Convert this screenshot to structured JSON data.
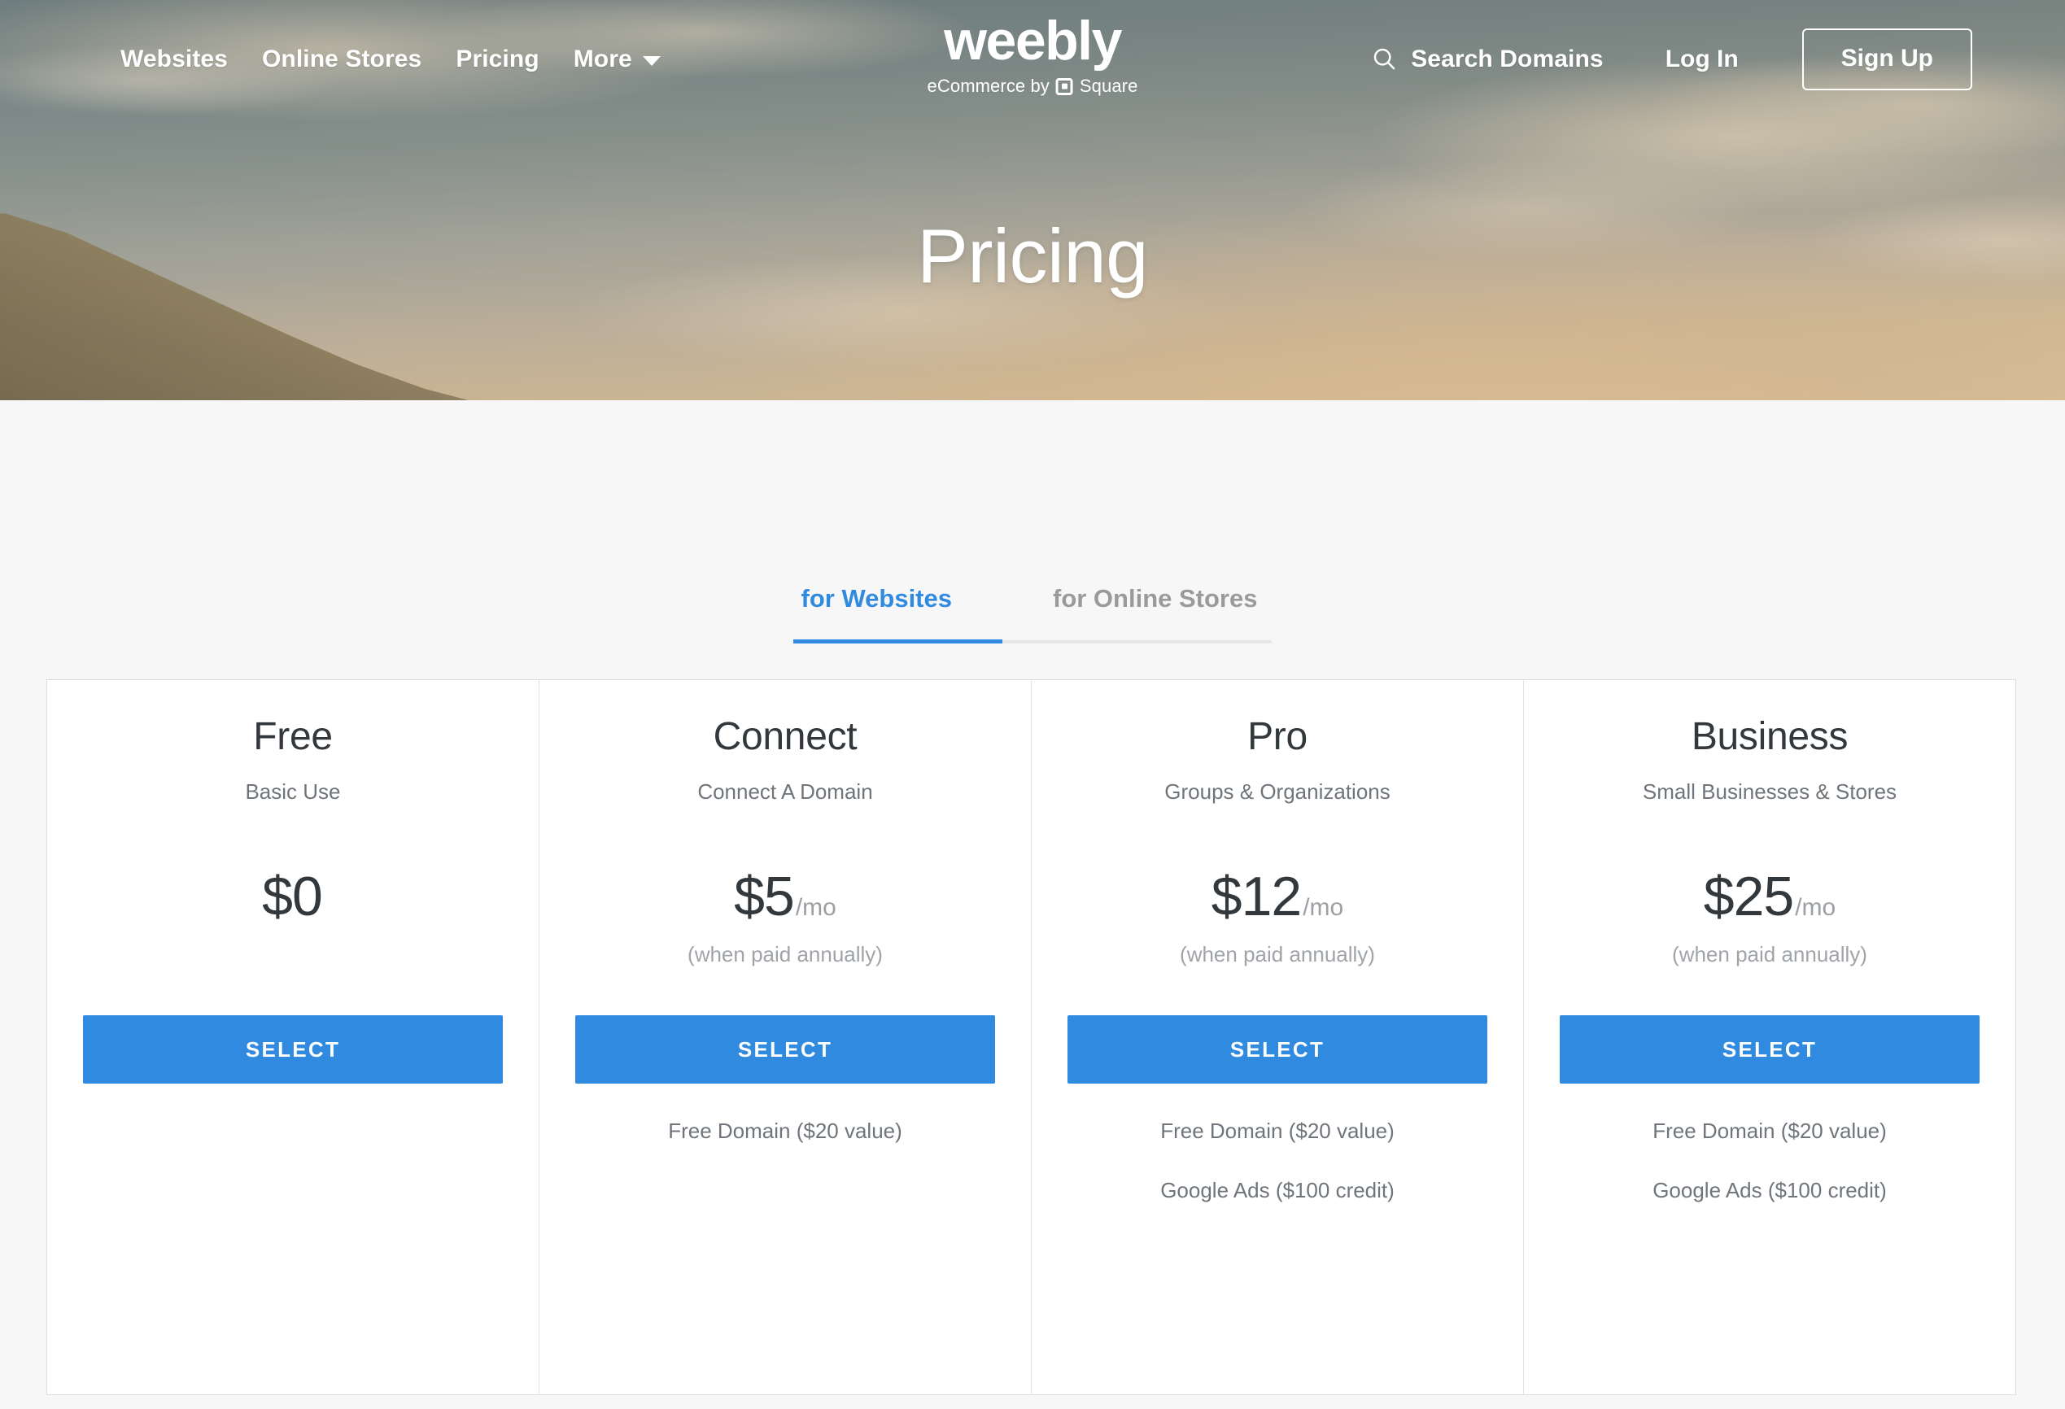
{
  "nav": {
    "links": [
      {
        "label": "Websites"
      },
      {
        "label": "Online Stores"
      },
      {
        "label": "Pricing"
      },
      {
        "label": "More"
      }
    ],
    "logo": {
      "wordmark": "weebly",
      "tagline_before": "eCommerce by",
      "tagline_after": "Square",
      "square_icon": "square-logo-icon"
    },
    "search_domains_label": "Search Domains",
    "search_icon": "search-icon",
    "caret_icon": "chevron-down-icon",
    "login_label": "Log In",
    "signup_label": "Sign Up"
  },
  "hero": {
    "title": "Pricing"
  },
  "tabs": [
    {
      "label": "for Websites",
      "active": true
    },
    {
      "label": "for Online Stores",
      "active": false
    }
  ],
  "colors": {
    "accent_blue": "#2f8ae0",
    "tab_inactive": "#9a9a9a",
    "page_bg": "#f7f7f7",
    "card_bg": "#ffffff",
    "heading": "#33383c",
    "muted": "#6f757a"
  },
  "plans": [
    {
      "name": "Free",
      "tagline": "Basic Use",
      "price_amount": "$0",
      "price_period": "",
      "billing_note": "",
      "cta_label": "SELECT",
      "features": []
    },
    {
      "name": "Connect",
      "tagline": "Connect A Domain",
      "price_amount": "$5",
      "price_period": "/mo",
      "billing_note": "(when paid annually)",
      "cta_label": "SELECT",
      "features": [
        "Free Domain ($20 value)"
      ]
    },
    {
      "name": "Pro",
      "tagline": "Groups & Organizations",
      "price_amount": "$12",
      "price_period": "/mo",
      "billing_note": "(when paid annually)",
      "cta_label": "SELECT",
      "features": [
        "Free Domain ($20 value)",
        "Google Ads ($100 credit)"
      ]
    },
    {
      "name": "Business",
      "tagline": "Small Businesses & Stores",
      "price_amount": "$25",
      "price_period": "/mo",
      "billing_note": "(when paid annually)",
      "cta_label": "SELECT",
      "features": [
        "Free Domain ($20 value)",
        "Google Ads ($100 credit)"
      ]
    }
  ]
}
